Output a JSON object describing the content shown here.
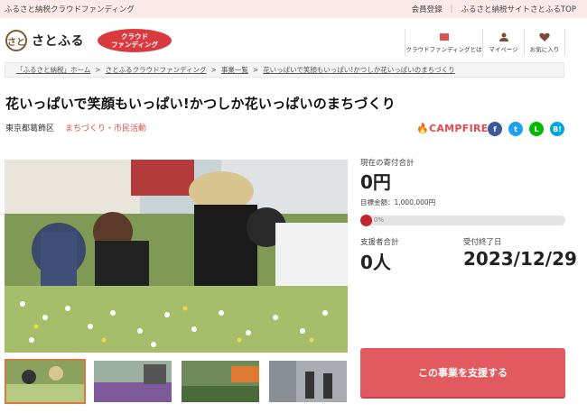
{
  "topbar": {
    "brand": "ふるさと納税クラウドファンディング",
    "links": [
      "会員登録",
      "ふるさと納税サイトさとふるTOP"
    ]
  },
  "header": {
    "logo_mark": "さと",
    "logo_text": "さとふる",
    "badge_line1": "クラウド",
    "badge_line2": "ファンディング",
    "nav": [
      {
        "label": "クラウドファンディングとは",
        "icon": "book-icon"
      },
      {
        "label": "マイページ",
        "icon": "person-icon"
      },
      {
        "label": "お気に入り",
        "icon": "heart-icon"
      }
    ]
  },
  "breadcrumb": {
    "items": [
      "「ふるさと納税」ホーム",
      "さとふるクラウドファンディング",
      "事業一覧",
      "花いっぱいで笑顔もいっぱい!かつしか花いっぱいのまちづくり"
    ],
    "separator": ">"
  },
  "project": {
    "title": "花いっぱいで笑顔もいっぱい!かつしか花いっぱいのまちづくり",
    "location": "東京都葛飾区",
    "category": "まちづくり・市民活動"
  },
  "campfire": "CAMPFIRE",
  "share": {
    "facebook": "f",
    "twitter": "t",
    "line": "L",
    "hatena": "B!"
  },
  "stats": {
    "current_label": "現在の寄付合計",
    "current_value": "0円",
    "target": "目標金額：1,000,000円",
    "progress_label": "0%",
    "progress": 0,
    "supporters_label": "支援者合計",
    "supporters_value": "0人",
    "deadline_label": "受付終了日",
    "deadline_value": "2023/12/29"
  },
  "cta": {
    "label": "この事業を支援する"
  },
  "colors": {
    "accent": "#e05a5f",
    "brand_red": "#d93a3f",
    "topbar_bg": "#fce9ea",
    "campfire": "#e5484d",
    "facebook": "#3b5998",
    "twitter": "#1da1f2",
    "line": "#00b900",
    "hatena": "#00a4de"
  }
}
